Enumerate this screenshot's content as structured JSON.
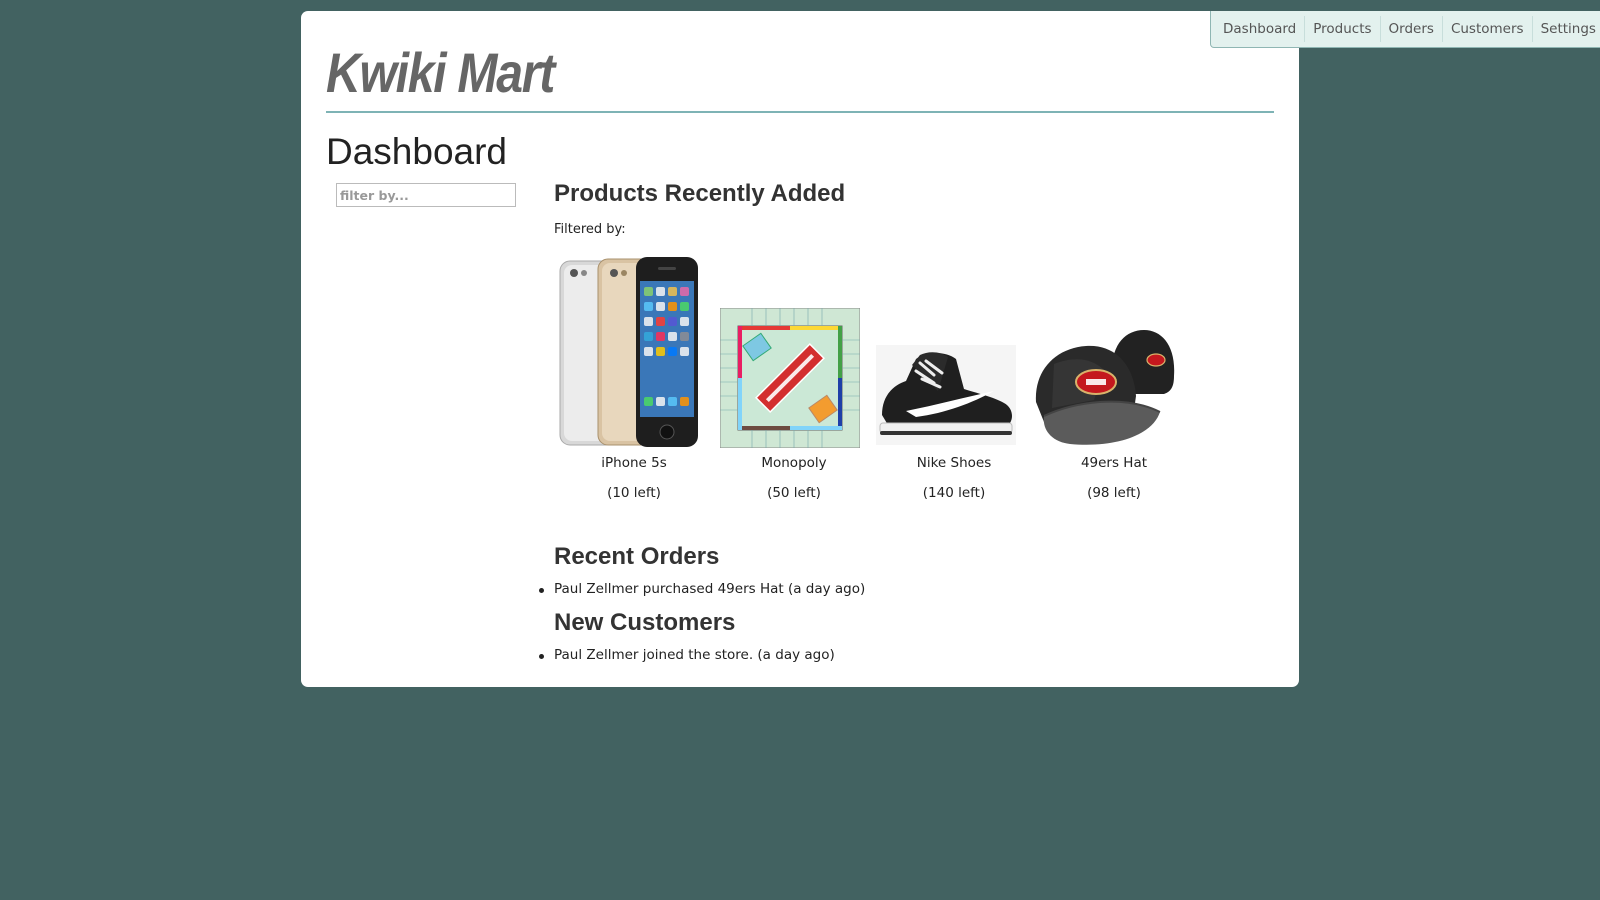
{
  "nav": {
    "items": [
      "Dashboard",
      "Products",
      "Orders",
      "Customers",
      "Settings"
    ]
  },
  "brand": {
    "name": "Kwiki Mart"
  },
  "page": {
    "title": "Dashboard"
  },
  "filter": {
    "placeholder": "filter by..."
  },
  "products_section": {
    "title": "Products Recently Added",
    "filtered_label": "Filtered by:",
    "items": [
      {
        "name": "iPhone 5s",
        "stock": "(10 left)",
        "icon": "iphone-image"
      },
      {
        "name": "Monopoly",
        "stock": "(50 left)",
        "icon": "monopoly-board-image"
      },
      {
        "name": "Nike Shoes",
        "stock": "(140 left)",
        "icon": "sneaker-image"
      },
      {
        "name": "49ers Hat",
        "stock": "(98 left)",
        "icon": "cap-image"
      }
    ]
  },
  "orders_section": {
    "title": "Recent Orders",
    "items": [
      "Paul Zellmer purchased 49ers Hat (a day ago)"
    ]
  },
  "customers_section": {
    "title": "New Customers",
    "items": [
      "Paul Zellmer joined the store. (a day ago)"
    ]
  },
  "colors": {
    "background": "#426261",
    "nav_bg": "#e3f1ee",
    "brand_rule": "#7eb3b5",
    "niners_red": "#c4181e"
  }
}
